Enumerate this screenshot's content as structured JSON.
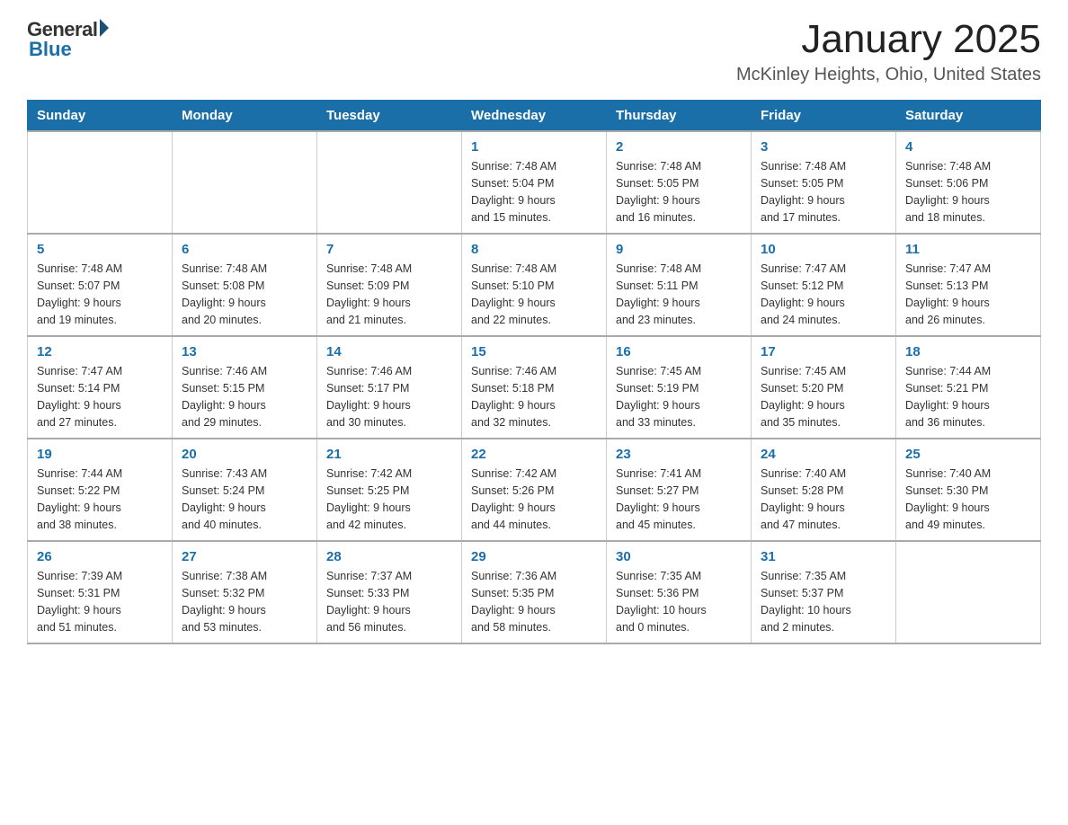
{
  "header": {
    "logo_general": "General",
    "logo_blue": "Blue",
    "month_title": "January 2025",
    "location": "McKinley Heights, Ohio, United States"
  },
  "weekdays": [
    "Sunday",
    "Monday",
    "Tuesday",
    "Wednesday",
    "Thursday",
    "Friday",
    "Saturday"
  ],
  "weeks": [
    [
      {
        "day": "",
        "info": ""
      },
      {
        "day": "",
        "info": ""
      },
      {
        "day": "",
        "info": ""
      },
      {
        "day": "1",
        "info": "Sunrise: 7:48 AM\nSunset: 5:04 PM\nDaylight: 9 hours\nand 15 minutes."
      },
      {
        "day": "2",
        "info": "Sunrise: 7:48 AM\nSunset: 5:05 PM\nDaylight: 9 hours\nand 16 minutes."
      },
      {
        "day": "3",
        "info": "Sunrise: 7:48 AM\nSunset: 5:05 PM\nDaylight: 9 hours\nand 17 minutes."
      },
      {
        "day": "4",
        "info": "Sunrise: 7:48 AM\nSunset: 5:06 PM\nDaylight: 9 hours\nand 18 minutes."
      }
    ],
    [
      {
        "day": "5",
        "info": "Sunrise: 7:48 AM\nSunset: 5:07 PM\nDaylight: 9 hours\nand 19 minutes."
      },
      {
        "day": "6",
        "info": "Sunrise: 7:48 AM\nSunset: 5:08 PM\nDaylight: 9 hours\nand 20 minutes."
      },
      {
        "day": "7",
        "info": "Sunrise: 7:48 AM\nSunset: 5:09 PM\nDaylight: 9 hours\nand 21 minutes."
      },
      {
        "day": "8",
        "info": "Sunrise: 7:48 AM\nSunset: 5:10 PM\nDaylight: 9 hours\nand 22 minutes."
      },
      {
        "day": "9",
        "info": "Sunrise: 7:48 AM\nSunset: 5:11 PM\nDaylight: 9 hours\nand 23 minutes."
      },
      {
        "day": "10",
        "info": "Sunrise: 7:47 AM\nSunset: 5:12 PM\nDaylight: 9 hours\nand 24 minutes."
      },
      {
        "day": "11",
        "info": "Sunrise: 7:47 AM\nSunset: 5:13 PM\nDaylight: 9 hours\nand 26 minutes."
      }
    ],
    [
      {
        "day": "12",
        "info": "Sunrise: 7:47 AM\nSunset: 5:14 PM\nDaylight: 9 hours\nand 27 minutes."
      },
      {
        "day": "13",
        "info": "Sunrise: 7:46 AM\nSunset: 5:15 PM\nDaylight: 9 hours\nand 29 minutes."
      },
      {
        "day": "14",
        "info": "Sunrise: 7:46 AM\nSunset: 5:17 PM\nDaylight: 9 hours\nand 30 minutes."
      },
      {
        "day": "15",
        "info": "Sunrise: 7:46 AM\nSunset: 5:18 PM\nDaylight: 9 hours\nand 32 minutes."
      },
      {
        "day": "16",
        "info": "Sunrise: 7:45 AM\nSunset: 5:19 PM\nDaylight: 9 hours\nand 33 minutes."
      },
      {
        "day": "17",
        "info": "Sunrise: 7:45 AM\nSunset: 5:20 PM\nDaylight: 9 hours\nand 35 minutes."
      },
      {
        "day": "18",
        "info": "Sunrise: 7:44 AM\nSunset: 5:21 PM\nDaylight: 9 hours\nand 36 minutes."
      }
    ],
    [
      {
        "day": "19",
        "info": "Sunrise: 7:44 AM\nSunset: 5:22 PM\nDaylight: 9 hours\nand 38 minutes."
      },
      {
        "day": "20",
        "info": "Sunrise: 7:43 AM\nSunset: 5:24 PM\nDaylight: 9 hours\nand 40 minutes."
      },
      {
        "day": "21",
        "info": "Sunrise: 7:42 AM\nSunset: 5:25 PM\nDaylight: 9 hours\nand 42 minutes."
      },
      {
        "day": "22",
        "info": "Sunrise: 7:42 AM\nSunset: 5:26 PM\nDaylight: 9 hours\nand 44 minutes."
      },
      {
        "day": "23",
        "info": "Sunrise: 7:41 AM\nSunset: 5:27 PM\nDaylight: 9 hours\nand 45 minutes."
      },
      {
        "day": "24",
        "info": "Sunrise: 7:40 AM\nSunset: 5:28 PM\nDaylight: 9 hours\nand 47 minutes."
      },
      {
        "day": "25",
        "info": "Sunrise: 7:40 AM\nSunset: 5:30 PM\nDaylight: 9 hours\nand 49 minutes."
      }
    ],
    [
      {
        "day": "26",
        "info": "Sunrise: 7:39 AM\nSunset: 5:31 PM\nDaylight: 9 hours\nand 51 minutes."
      },
      {
        "day": "27",
        "info": "Sunrise: 7:38 AM\nSunset: 5:32 PM\nDaylight: 9 hours\nand 53 minutes."
      },
      {
        "day": "28",
        "info": "Sunrise: 7:37 AM\nSunset: 5:33 PM\nDaylight: 9 hours\nand 56 minutes."
      },
      {
        "day": "29",
        "info": "Sunrise: 7:36 AM\nSunset: 5:35 PM\nDaylight: 9 hours\nand 58 minutes."
      },
      {
        "day": "30",
        "info": "Sunrise: 7:35 AM\nSunset: 5:36 PM\nDaylight: 10 hours\nand 0 minutes."
      },
      {
        "day": "31",
        "info": "Sunrise: 7:35 AM\nSunset: 5:37 PM\nDaylight: 10 hours\nand 2 minutes."
      },
      {
        "day": "",
        "info": ""
      }
    ]
  ]
}
